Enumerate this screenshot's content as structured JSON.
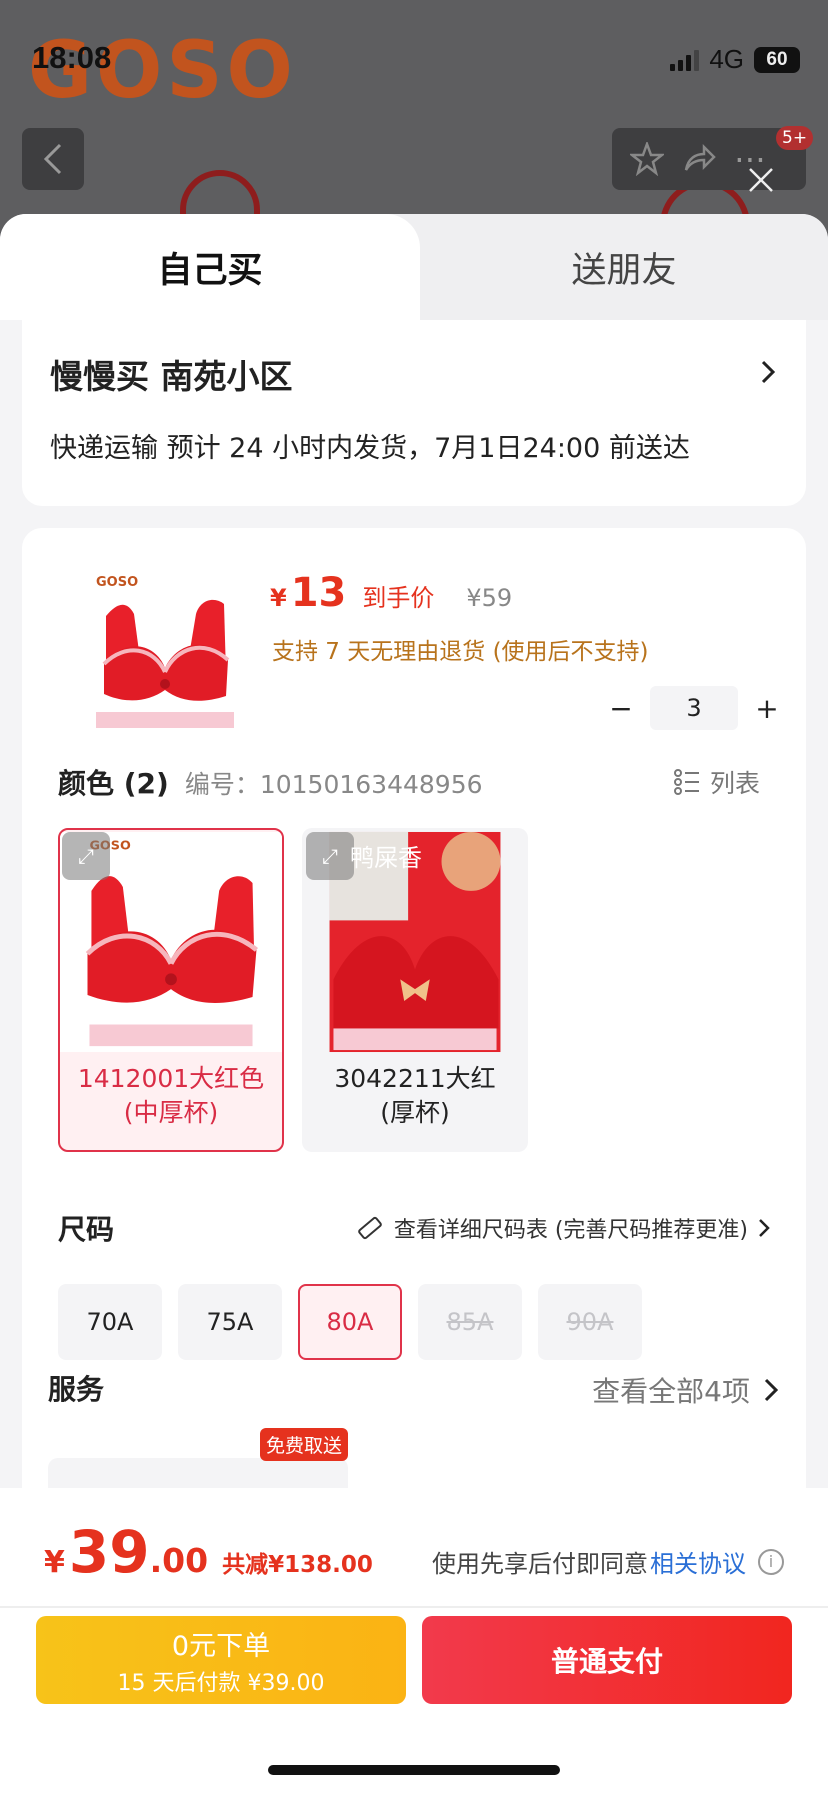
{
  "status_bar": {
    "time": "18:08",
    "network": "4G",
    "battery": "60"
  },
  "background": {
    "brand_logo": "GOSO",
    "badge": "5+"
  },
  "tabs": {
    "self": "自己买",
    "friend": "送朋友"
  },
  "address": {
    "title": "慢慢买  南苑小区",
    "shipping": "快递运输 预计 24 小时内发货，7月1日24:00 前送达"
  },
  "product": {
    "currency": "¥",
    "price": "13",
    "price_label": "到手价",
    "original_price": "¥59",
    "return_policy": "支持 7 天无理由退货 (使用后不支持)",
    "quantity": "3",
    "minus": "−",
    "plus": "+"
  },
  "color": {
    "title": "颜色 (2)",
    "code": "编号：10150163448956",
    "list_label": "列表",
    "options": [
      {
        "label": "1412001大红色\n(中厚杯)",
        "selected": true
      },
      {
        "label": "3042211大红\n(厚杯)",
        "overlay": "鸭屎香",
        "selected": false
      }
    ]
  },
  "size": {
    "title": "尺码",
    "guide": "查看详细尺码表 (完善尺码推荐更准)",
    "options": [
      {
        "label": "70A",
        "state": "normal"
      },
      {
        "label": "75A",
        "state": "normal"
      },
      {
        "label": "80A",
        "state": "selected"
      },
      {
        "label": "85A",
        "state": "disabled"
      },
      {
        "label": "90A",
        "state": "disabled"
      }
    ]
  },
  "service": {
    "title": "服务",
    "view_all": "查看全部4项",
    "free_tag": "免费取送"
  },
  "footer": {
    "currency": "¥",
    "total_int": "39",
    "total_dec": ".00",
    "savings": "共减¥138.00",
    "agree_text": "使用先享后付即同意",
    "agree_link": "相关协议",
    "btn_later_line1": "0元下单",
    "btn_later_line2": "15 天后付款 ¥39.00",
    "btn_pay": "普通支付"
  },
  "colors": {
    "accent_red": "#e5321e",
    "select_pink": "#e0334a",
    "link_blue": "#2a6fd6",
    "policy_gold": "#b8731c"
  }
}
